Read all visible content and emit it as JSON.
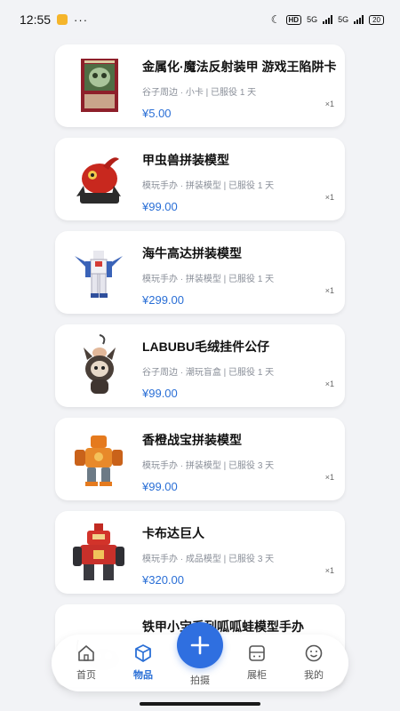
{
  "status_bar": {
    "time": "12:55",
    "more": "···",
    "hd": "HD",
    "net1": "5G",
    "net2": "5G",
    "battery": "20"
  },
  "items": [
    {
      "title": "金属化·魔法反射装甲 游戏王陷阱卡",
      "meta": "谷子周边 · 小卡 | 已服役 1 天",
      "price": "¥5.00",
      "qty": "×1",
      "thumb_icon": "trap-card-icon"
    },
    {
      "title": "甲虫兽拼装模型",
      "meta": "模玩手办 · 拼装模型 | 已服役 1 天",
      "price": "¥99.00",
      "qty": "×1",
      "thumb_icon": "beetle-model-icon"
    },
    {
      "title": "海牛高达拼装模型",
      "meta": "模玩手办 · 拼装模型 | 已服役 1 天",
      "price": "¥299.00",
      "qty": "×1",
      "thumb_icon": "gundam-model-icon"
    },
    {
      "title": "LABUBU毛绒挂件公仔",
      "meta": "谷子周边 · 潮玩盲盒 | 已服役 1 天",
      "price": "¥99.00",
      "qty": "×1",
      "thumb_icon": "plush-doll-icon"
    },
    {
      "title": "香橙战宝拼装模型",
      "meta": "模玩手办 · 拼装模型 | 已服役 3 天",
      "price": "¥99.00",
      "qty": "×1",
      "thumb_icon": "orange-robot-icon"
    },
    {
      "title": "卡布达巨人",
      "meta": "模玩手办 · 成品模型 | 已服役 3 天",
      "price": "¥320.00",
      "qty": "×1",
      "thumb_icon": "red-robot-icon"
    },
    {
      "title": "铁甲小宝系列呱呱蛙模型手办",
      "meta": "",
      "price": "",
      "qty": "",
      "thumb_icon": "frog-model-icon"
    }
  ],
  "nav": {
    "home": "首页",
    "items": "物品",
    "capture": "拍摄",
    "cabinet": "展柜",
    "mine": "我的",
    "active_color": "#2a6fd6"
  }
}
